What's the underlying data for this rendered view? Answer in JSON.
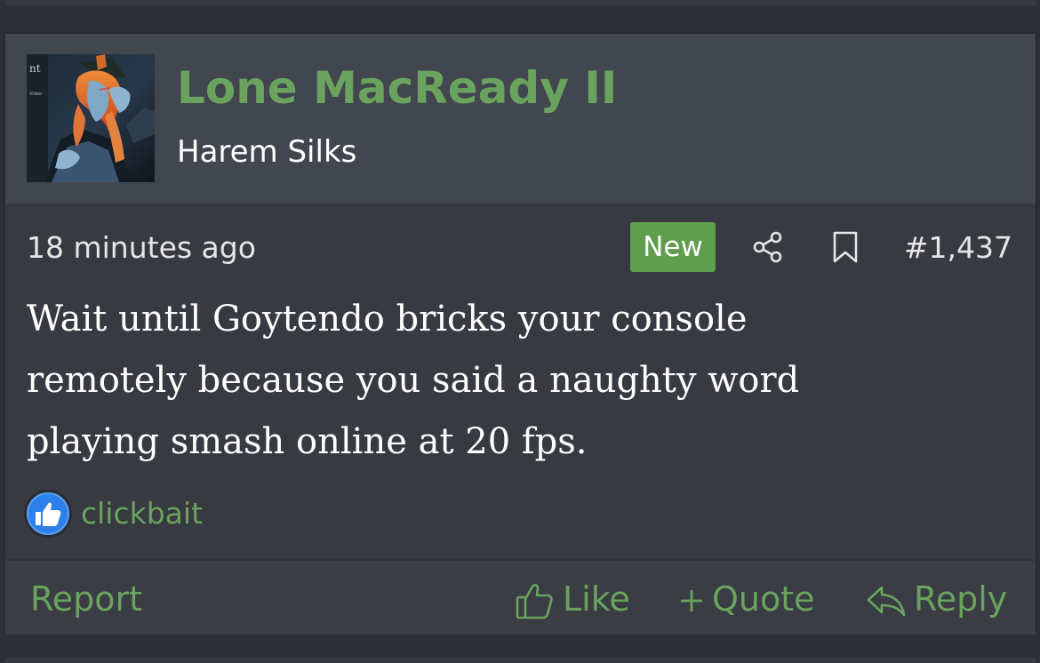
{
  "post": {
    "author": {
      "username": "Lone MacReady II",
      "user_title": "Harem Silks",
      "avatar": "user-avatar-image"
    },
    "timestamp": "18 minutes ago",
    "new_badge": "New",
    "post_number": "#1,437",
    "message": "Wait until Goytendo bricks your console remotely because you said a naughty word playing smash online at 20 fps.",
    "reaction": {
      "icon": "thumbs-up-icon",
      "user": "clickbait"
    },
    "actions": {
      "report": "Report",
      "like": "Like",
      "quote": "Quote",
      "reply": "Reply"
    }
  },
  "colors": {
    "page_background": "#2c2f35",
    "post_background": "#373a41",
    "header_background": "#42464f",
    "accent_green": "#6aa35d",
    "badge_green": "#5f9e4c",
    "reaction_blue": "#2d7fea"
  }
}
